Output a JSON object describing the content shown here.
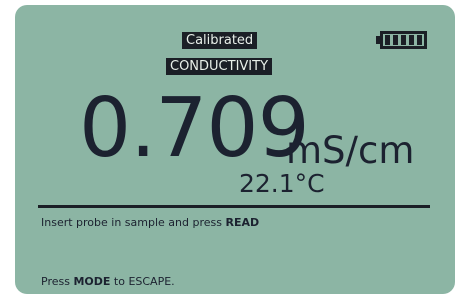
{
  "status": {
    "calibration": "Calibrated",
    "mode": "CONDUCTIVITY",
    "battery_icon": "battery-full-icon",
    "battery_level": 1.0
  },
  "measurement": {
    "value": "0.709",
    "unit": "mS/cm",
    "temperature": "22.1°C"
  },
  "messages": {
    "line1_text": "Insert probe in sample and press ",
    "line1_key": "READ",
    "line2_pre": "Press ",
    "line2_key": "MODE",
    "line2_post": " to ESCAPE."
  },
  "colors": {
    "screen": "#8cb5a4",
    "ink": "#1c2230"
  }
}
